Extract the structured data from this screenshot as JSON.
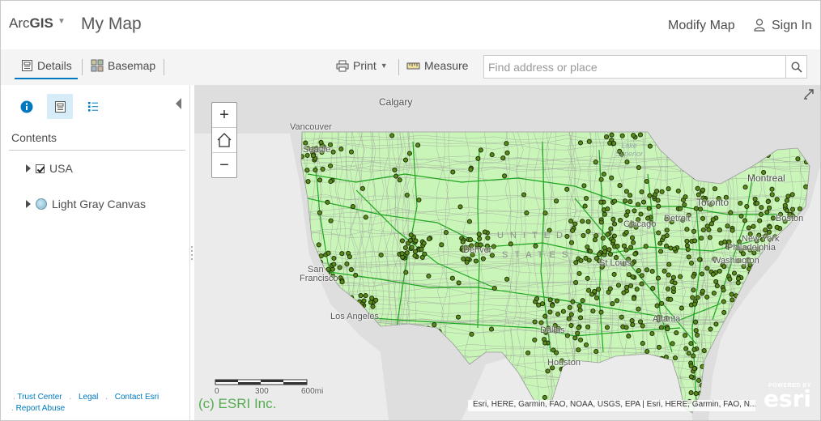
{
  "app": {
    "brand_plain": "Arc",
    "brand_bold": "GIS",
    "map_title": "My Map",
    "modify_map": "Modify Map",
    "sign_in": "Sign In"
  },
  "toolbar": {
    "details": "Details",
    "basemap": "Basemap",
    "print": "Print",
    "measure": "Measure",
    "search_placeholder": "Find address or place"
  },
  "panel": {
    "contents_title": "Contents",
    "layers": [
      {
        "label": "USA",
        "checked": true
      },
      {
        "label": "Light Gray Canvas",
        "icon": "globe-icon"
      }
    ],
    "footer": {
      "trust_center": "Trust Center",
      "legal": "Legal",
      "contact_esri": "Contact Esri",
      "report_abuse": "Report Abuse"
    }
  },
  "map": {
    "cities": {
      "calgary": "Calgary",
      "vancouver": "Vancouver",
      "seattle": "Seattle",
      "montreal": "Montreal",
      "toronto": "Toronto",
      "chicago": "Chicago",
      "detroit": "Detroit",
      "boston": "Boston",
      "new_york": "New York",
      "philadelphia": "Philadelphia",
      "washington": "Washington",
      "st_louis": "St Louis",
      "denver": "Denver",
      "san": "San",
      "francisco": "Francisco",
      "los_angeles": "Los Angeles",
      "dallas": "Dallas",
      "houston": "Houston",
      "atlanta": "Atlanta"
    },
    "lake_superior": "Lake\nSuperior",
    "country_line1": "UNITED",
    "country_line2": "STATES",
    "scale_labels": [
      "0",
      "300",
      "600mi"
    ],
    "attribution": "Esri, HERE, Garmin, FAO, NOAA, USGS, EPA | Esri, HERE, Garmin, FAO, N...",
    "copyright": "(c) ESRI Inc.",
    "esri_powered": "POWERED BY",
    "esri_name": "esri",
    "colors": {
      "land": "#c9f5b8",
      "county_lines": "#9a9a9a",
      "roads": "#1fa51f",
      "points": "#5a8a1a",
      "basemap": "#dcdcdc",
      "water": "#e8e8e8"
    }
  }
}
